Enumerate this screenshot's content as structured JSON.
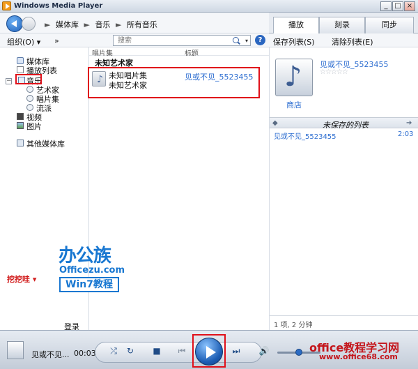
{
  "window": {
    "title": "Windows Media Player",
    "min": "_",
    "max": "□",
    "close": "×"
  },
  "nav": {
    "breadcrumb": [
      "媒体库",
      "音乐",
      "所有音乐"
    ],
    "sep": "►"
  },
  "tabs": [
    "播放",
    "刻录",
    "同步"
  ],
  "toolbar": {
    "organize": "组织(O) ▾",
    "more": "»",
    "search_placeholder": "搜索",
    "search_arrow": "▾",
    "help": "?"
  },
  "right_toolbar": {
    "save_list": "保存列表(S)",
    "clear_list": "清除列表(E)"
  },
  "sidebar": {
    "items": [
      "媒体库",
      "播放列表",
      "音乐",
      "艺术家",
      "唱片集",
      "流派",
      "视频",
      "图片",
      "其他媒体库"
    ],
    "login": "登录",
    "collapse": "−"
  },
  "columns": [
    "唱片集",
    "标题"
  ],
  "library": {
    "artist_heading": "未知艺术家",
    "album": "未知唱片集",
    "artist": "未知艺术家",
    "track_title": "见或不见_5523455",
    "note": "♪"
  },
  "now_playing_panel": {
    "track": "见或不见_5523455",
    "stars": "☆☆☆☆☆",
    "store": "商店",
    "list_title": "未保存的列表",
    "left_arrow": "◆",
    "right_arrow": "➔",
    "list_items": [
      {
        "title": "见或不见_5523455",
        "duration": "2:03"
      }
    ],
    "status": "1 项, 2 分钟"
  },
  "watermark": {
    "brand_cn": "办公族",
    "brand_en": "Officezu.com",
    "win7": "Win7教程",
    "user": "挖挖哇 ▾"
  },
  "player": {
    "now_playing": "见或不见...",
    "time": "00:03",
    "shuffle": "⤮",
    "repeat": "↻",
    "stop": "■",
    "prev": "⏮",
    "next": "⏭",
    "volume": "🔊"
  },
  "brand": {
    "text": "office教程学习网",
    "url": "www.office68.com"
  },
  "colors": {
    "accent": "#1b5cb3",
    "highlight": "#e0101a",
    "link": "#2f6fd1"
  }
}
